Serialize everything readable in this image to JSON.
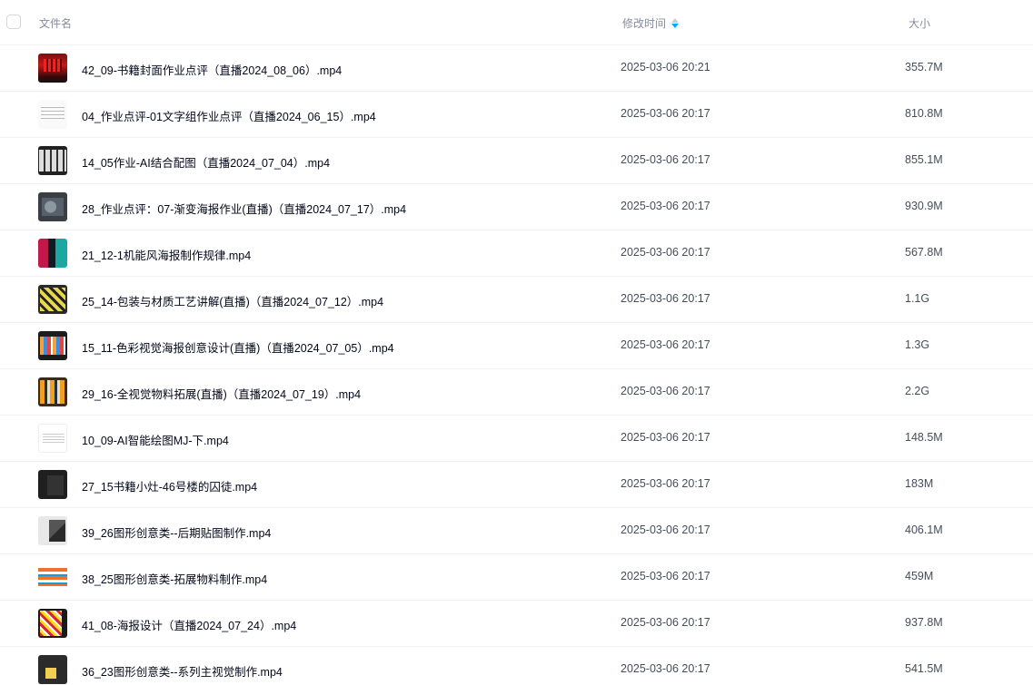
{
  "header": {
    "name_label": "文件名",
    "time_label": "修改时间",
    "size_label": "大小",
    "sort_icon": "sort-desc-icon",
    "accent_color": "#06a7ff"
  },
  "files": [
    {
      "name": "42_09-书籍封面作业点评（直播2024_08_06）.mp4",
      "time": "2025-03-06 20:21",
      "size": "355.7M",
      "thumb": "t-red"
    },
    {
      "name": "04_作业点评-01文字组作业点评（直播2024_06_15）.mp4",
      "time": "2025-03-06 20:17",
      "size": "810.8M",
      "thumb": "t-doc"
    },
    {
      "name": "14_05作业-AI结合配图（直播2024_07_04）.mp4",
      "time": "2025-03-06 20:17",
      "size": "855.1M",
      "thumb": "t-grid"
    },
    {
      "name": "28_作业点评：07-渐变海报作业(直播)（直播2024_07_17）.mp4",
      "time": "2025-03-06 20:17",
      "size": "930.9M",
      "thumb": "t-gray"
    },
    {
      "name": "21_12-1机能风海报制作规律.mp4",
      "time": "2025-03-06 20:17",
      "size": "567.8M",
      "thumb": "t-teal"
    },
    {
      "name": "25_14-包装与材质工艺讲解(直播)（直播2024_07_12）.mp4",
      "time": "2025-03-06 20:17",
      "size": "1.1G",
      "thumb": "t-yellow"
    },
    {
      "name": "15_11-色彩视觉海报创意设计(直播)（直播2024_07_05）.mp4",
      "time": "2025-03-06 20:17",
      "size": "1.3G",
      "thumb": "t-color"
    },
    {
      "name": "29_16-全视觉物料拓展(直播)（直播2024_07_19）.mp4",
      "time": "2025-03-06 20:17",
      "size": "2.2G",
      "thumb": "t-orange"
    },
    {
      "name": "10_09-AI智能绘图MJ-下.mp4",
      "time": "2025-03-06 20:17",
      "size": "148.5M",
      "thumb": "t-white"
    },
    {
      "name": "27_15书籍小灶-46号楼的囚徒.mp4",
      "time": "2025-03-06 20:17",
      "size": "183M",
      "thumb": "t-dark"
    },
    {
      "name": "39_26图形创意类--后期贴图制作.mp4",
      "time": "2025-03-06 20:17",
      "size": "406.1M",
      "thumb": "t-mixed"
    },
    {
      "name": "38_25图形创意类-拓展物料制作.mp4",
      "time": "2025-03-06 20:17",
      "size": "459M",
      "thumb": "t-orwhite"
    },
    {
      "name": "41_08-海报设计（直播2024_07_24）.mp4",
      "time": "2025-03-06 20:17",
      "size": "937.8M",
      "thumb": "t-poster"
    },
    {
      "name": "36_23图形创意类--系列主视觉制作.mp4",
      "time": "2025-03-06 20:17",
      "size": "541.5M",
      "thumb": "t-last"
    }
  ]
}
